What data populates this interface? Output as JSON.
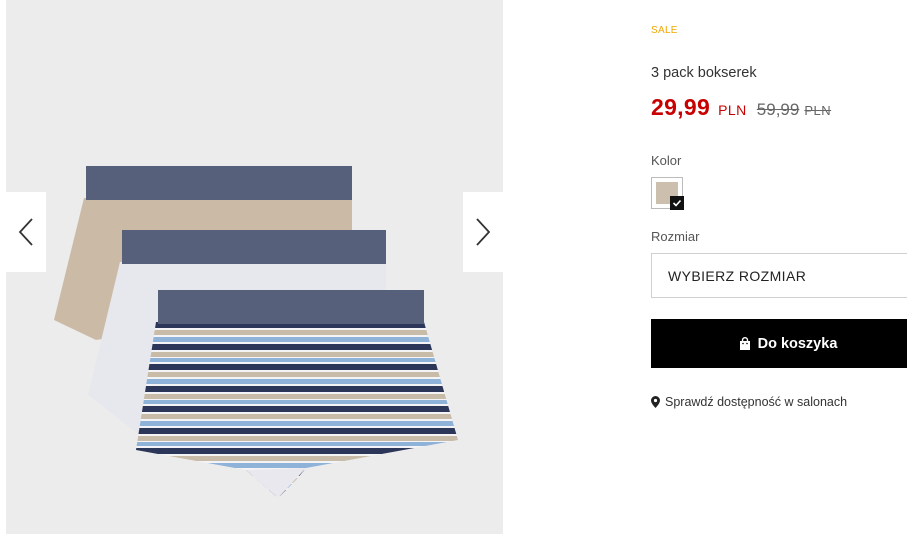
{
  "gallery": {
    "image_alt": "3 pack bokserek",
    "prev_icon": "chevron-left-icon",
    "next_icon": "chevron-right-icon"
  },
  "product": {
    "badge": "SALE",
    "title": "3 pack bokserek",
    "price": {
      "current": "29,99",
      "current_currency": "PLN",
      "old": "59,99",
      "old_currency": "PLN"
    },
    "color_label": "Kolor",
    "color_swatch": "#cdbfae",
    "size_label": "Rozmiar",
    "size_placeholder": "WYBIERZ ROZMIAR",
    "add_to_cart": "Do koszyka",
    "availability_link": "Sprawdź dostępność w salonach"
  },
  "colors": {
    "sale": "#f0a800",
    "price": "#c80000",
    "button_bg": "#000000"
  }
}
